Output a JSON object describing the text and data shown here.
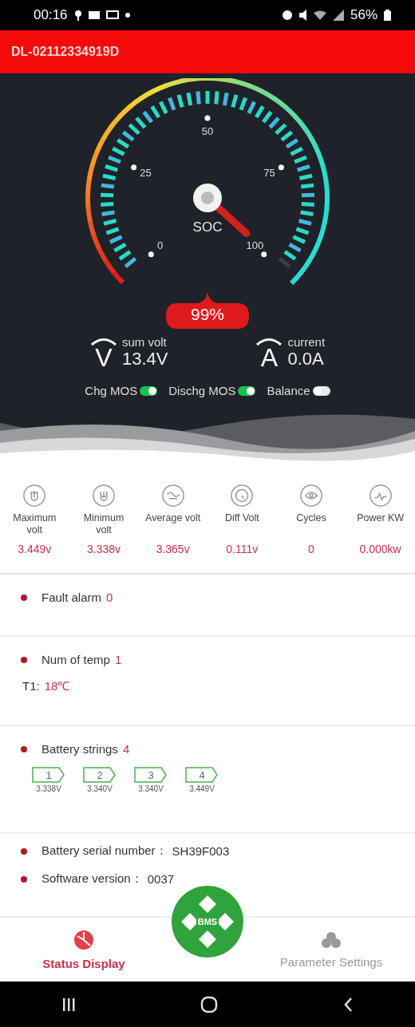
{
  "status_bar": {
    "time": "00:16",
    "battery": "56%"
  },
  "header": {
    "device_id": "DL-02112334919D"
  },
  "gauge": {
    "label": "SOC",
    "level": 0.99,
    "ticks": [
      "0",
      "25",
      "50",
      "75",
      "100"
    ],
    "percent": "99%"
  },
  "readings": [
    {
      "symbol": "V",
      "label": "sum volt",
      "value": "13.4V"
    },
    {
      "symbol": "A",
      "label": "current",
      "value": "0.0A"
    }
  ],
  "switches": [
    {
      "label": "Chg MOS",
      "on": true
    },
    {
      "label": "Dischg MOS",
      "on": true
    },
    {
      "label": "Balance",
      "on": false
    }
  ],
  "metrics": [
    {
      "label": "Maximum volt",
      "value": "3.449v"
    },
    {
      "label": "Minimum volt",
      "value": "3.338v"
    },
    {
      "label": "Average volt",
      "value": "3.365v"
    },
    {
      "label": "Diff Volt",
      "value": "0.111v"
    },
    {
      "label": "Cycles",
      "value": "0"
    },
    {
      "label": "Power KW",
      "value": "0.000kw"
    }
  ],
  "fault": {
    "label": "Fault alarm",
    "value": "0"
  },
  "temperature": {
    "label": "Num of temp",
    "count": "1",
    "sensors": [
      {
        "name": "T1:",
        "value": "18℃"
      }
    ]
  },
  "battery_strings": {
    "label": "Battery strings",
    "count": "4",
    "cells": [
      {
        "number": "1",
        "voltage": "3.338V"
      },
      {
        "number": "2",
        "voltage": "3.340V"
      },
      {
        "number": "3",
        "voltage": "3.340V"
      },
      {
        "number": "4",
        "voltage": "3.449V"
      }
    ]
  },
  "info": [
    {
      "label": "Battery serial number：",
      "value": "SH39F003"
    },
    {
      "label": "Software version：",
      "value": "0037"
    }
  ],
  "center_button": {
    "label": "BMS"
  },
  "nav": [
    {
      "label": "Status Display",
      "selected": true
    },
    {
      "label": "Parameter Settings",
      "selected": false
    }
  ]
}
